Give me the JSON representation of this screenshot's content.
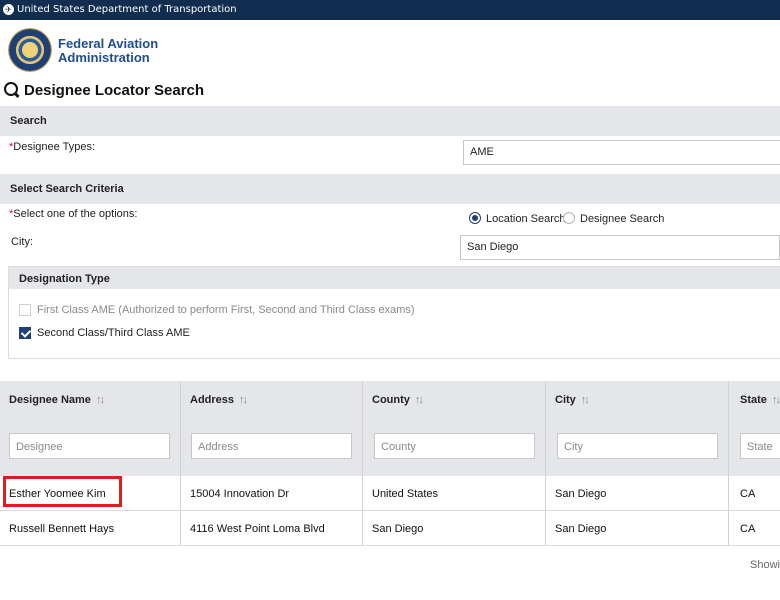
{
  "gov_banner": {
    "text": "United States Department of Transportation"
  },
  "agency": {
    "line1": "Federal Aviation",
    "line2": "Administration"
  },
  "page_title": "Designee Locator Search",
  "search_section": {
    "heading": "Search",
    "designee_types_label": "Designee Types:",
    "designee_types_value": "AME"
  },
  "criteria_section": {
    "heading": "Select Search Criteria",
    "options_label": "Select one of the options:",
    "radio_location": "Location Search",
    "radio_designee": "Designee Search",
    "selected_option": "Location Search",
    "city_label": "City:",
    "city_value": "San Diego"
  },
  "designation_type": {
    "heading": "Designation Type",
    "options": [
      {
        "label": "First Class AME (Authorized to perform First, Second and Third Class exams)",
        "checked": false,
        "disabled": true
      },
      {
        "label": "Second Class/Third Class AME",
        "checked": true,
        "disabled": false
      }
    ]
  },
  "table": {
    "columns": [
      {
        "header": "Designee Name",
        "filter_placeholder": "Designee"
      },
      {
        "header": "Address",
        "filter_placeholder": "Address"
      },
      {
        "header": "County",
        "filter_placeholder": "County"
      },
      {
        "header": "City",
        "filter_placeholder": "City"
      },
      {
        "header": "State",
        "filter_placeholder": "State"
      }
    ],
    "rows": [
      [
        "Esther Yoomee Kim",
        "15004 Innovation Dr",
        "United States",
        "San Diego",
        "CA"
      ],
      [
        "Russell Bennett Hays",
        "4116 West Point Loma Blvd",
        "San Diego",
        "San Diego",
        "CA"
      ]
    ],
    "footer_text": "Showi"
  },
  "colors": {
    "navy": "#112e51",
    "brand_blue": "#1f4e91",
    "required": "#c8102e",
    "highlight": "#e11b22",
    "band": "#e4e6ea"
  }
}
